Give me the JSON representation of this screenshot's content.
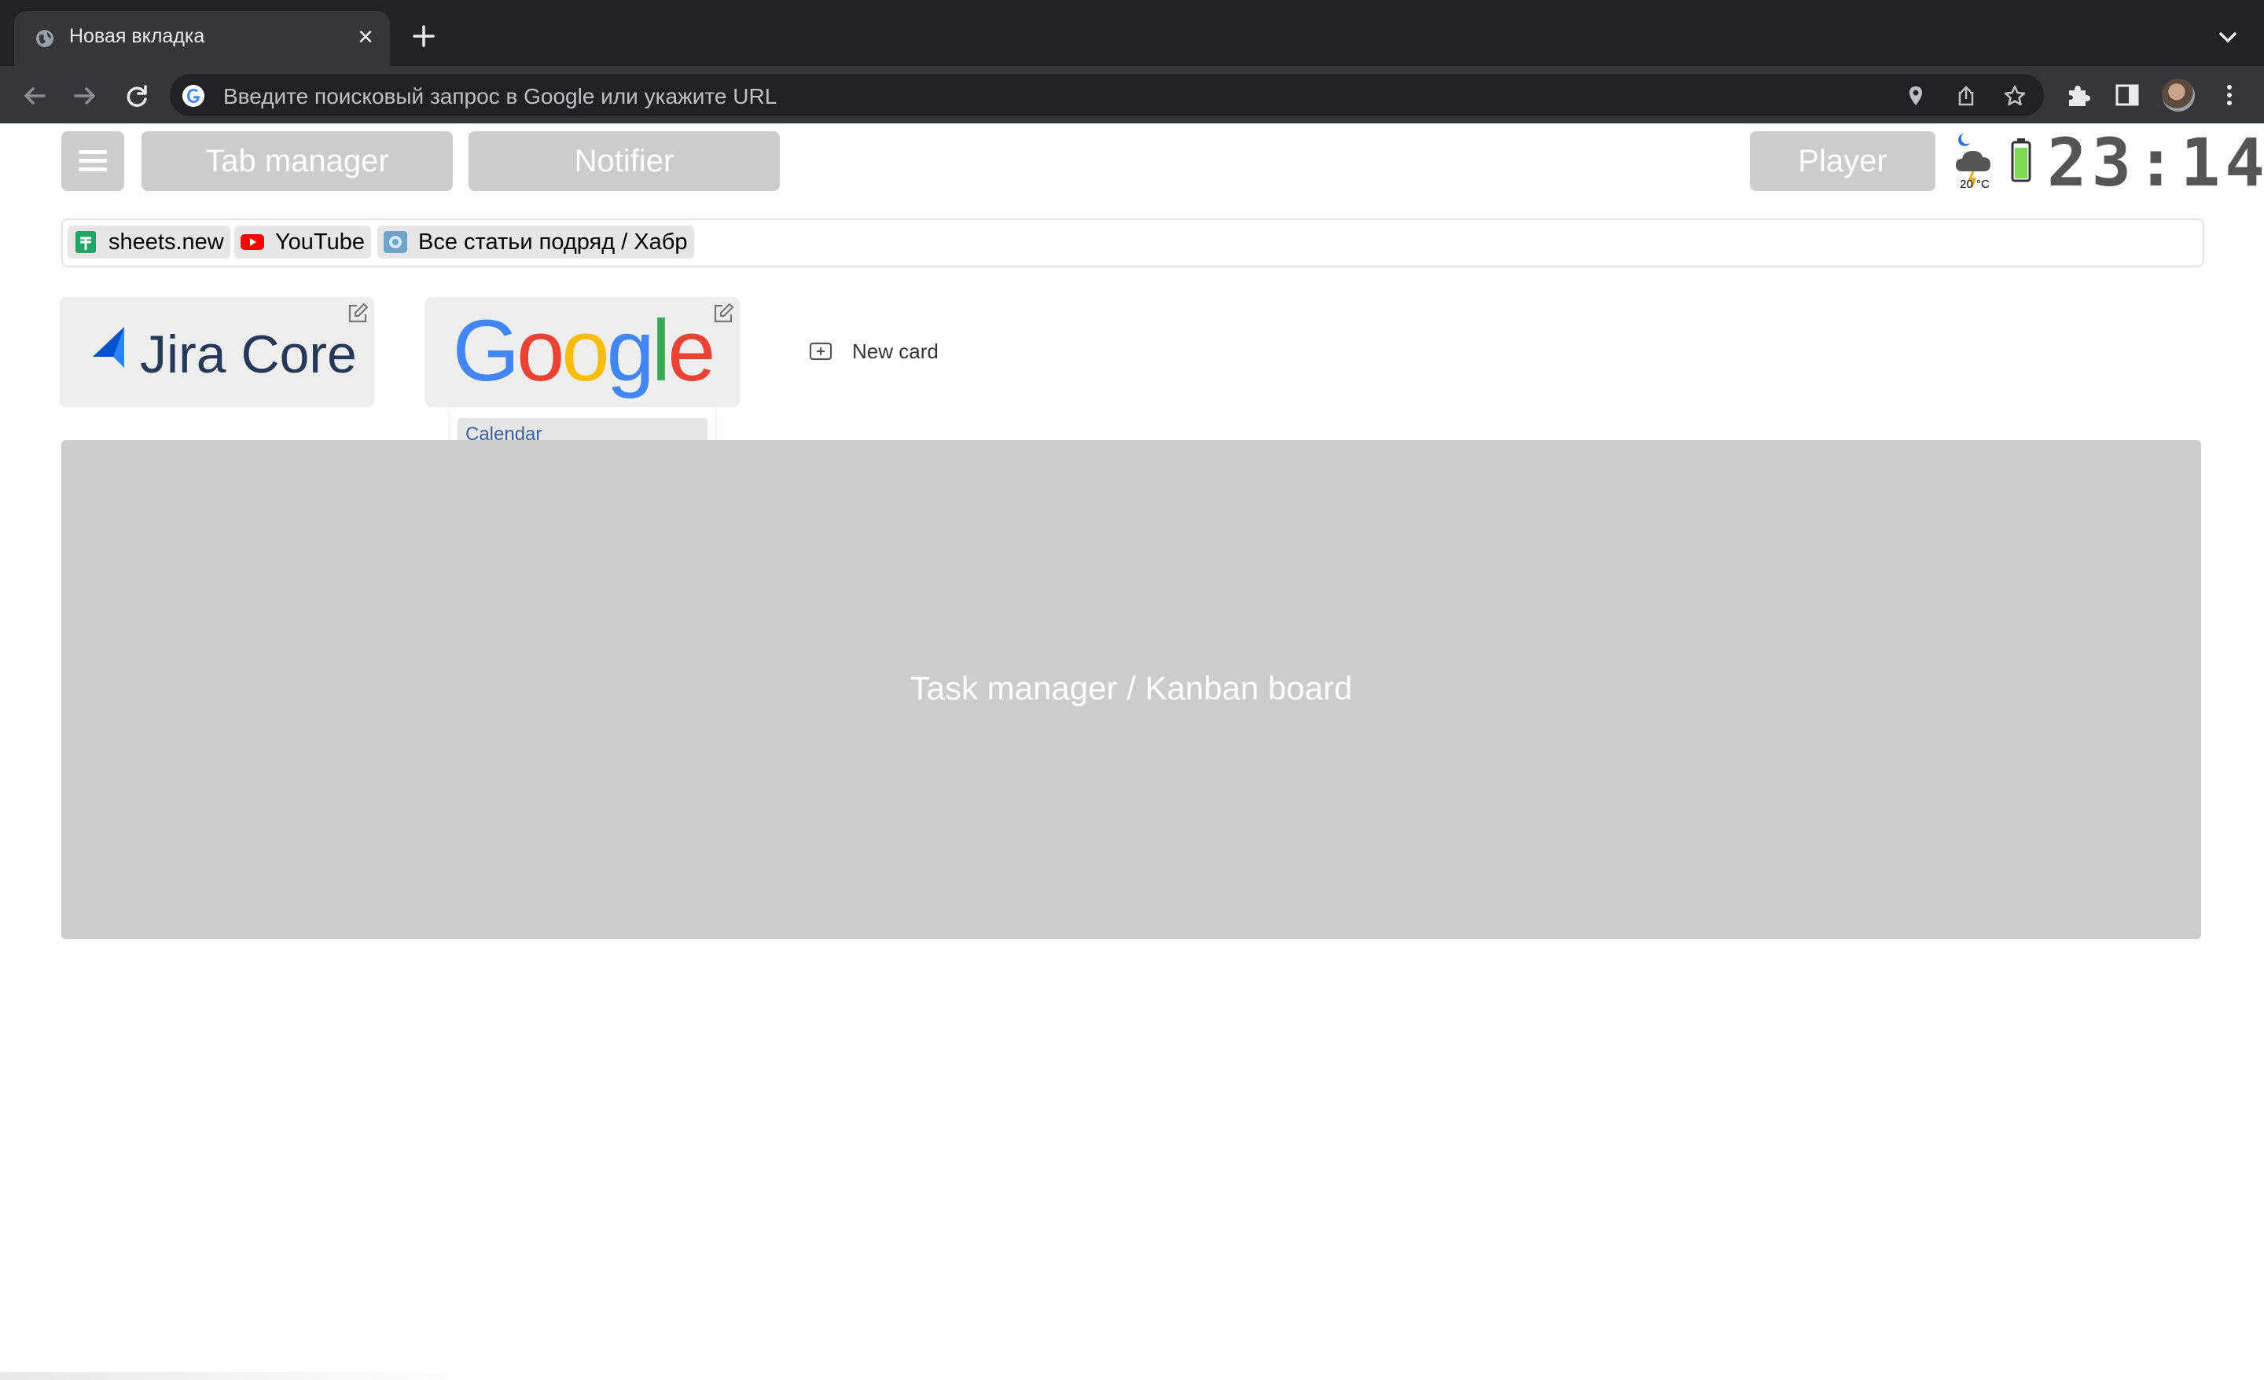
{
  "browser": {
    "tab_title": "Новая вкладка",
    "omnibox_placeholder": "Введите поисковый запрос в Google или укажите URL"
  },
  "header": {
    "tab_manager_label": "Tab manager",
    "notifier_label": "Notifier",
    "player_label": "Player",
    "weather_temp": "20 °C",
    "clock": "23:14",
    "battery_color": "#7ed957"
  },
  "bookmarks": [
    {
      "label": "sheets.new",
      "icon": "sheets-icon",
      "color": "#23a566"
    },
    {
      "label": "YouTube",
      "icon": "youtube-icon",
      "color": "#ff0000"
    },
    {
      "label": "Все статьи подряд / Хабр",
      "icon": "habr-icon",
      "color": "#6fa3c7"
    }
  ],
  "cards": [
    {
      "logo_text": "Jira Core",
      "icon": "jira-icon"
    },
    {
      "logo_text": "Google",
      "icon": "google-logo",
      "links": [
        "Calendar"
      ]
    }
  ],
  "new_card_label": "New card",
  "kanban_label": "Task manager / Kanban board"
}
